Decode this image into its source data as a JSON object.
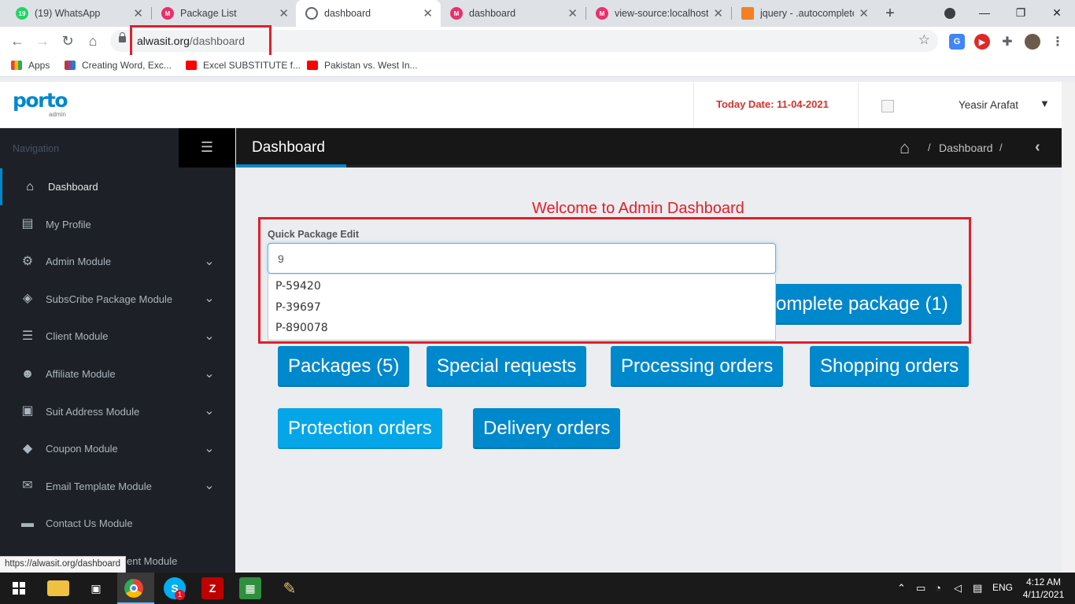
{
  "browser": {
    "tabs": [
      {
        "title": "(19) WhatsApp",
        "icon": "whatsapp-icon",
        "color": "#25d366",
        "badge": "19"
      },
      {
        "title": "Package List",
        "icon": "app-icon",
        "color": "#e8306b"
      },
      {
        "title": "dashboard",
        "icon": "globe-icon",
        "color": "#5f6368",
        "active": true
      },
      {
        "title": "dashboard",
        "icon": "app-icon",
        "color": "#e8306b"
      },
      {
        "title": "view-source:localhost/",
        "icon": "app-icon",
        "color": "#e8306b"
      },
      {
        "title": "jquery - .autocomplete",
        "icon": "stackoverflow-icon",
        "color": "#f48024"
      }
    ],
    "url_domain": "alwasit.org",
    "url_path": "/dashboard",
    "bookmarks": [
      {
        "label": "Apps",
        "icon": "apps-grid-icon"
      },
      {
        "label": "Creating Word, Exc...",
        "icon": "books-icon"
      },
      {
        "label": "Excel SUBSTITUTE f...",
        "icon": "youtube-icon"
      },
      {
        "label": "Pakistan vs. West In...",
        "icon": "youtube-icon"
      }
    ],
    "status_url": "https://alwasit.org/dashboard"
  },
  "header": {
    "logo_text": "porto",
    "logo_sub": "admin",
    "today_date": "Today Date: 11-04-2021",
    "user_name": "Yeasir Arafat"
  },
  "sidebar": {
    "nav_label": "Navigation",
    "items": [
      {
        "label": "Dashboard",
        "icon": "home-icon",
        "glyph": "⌂",
        "active": true,
        "has_caret": false
      },
      {
        "label": "My Profile",
        "icon": "id-card-icon",
        "glyph": "▤",
        "has_caret": false
      },
      {
        "label": "Admin Module",
        "icon": "users-cog-icon",
        "glyph": "⚙",
        "has_caret": true
      },
      {
        "label": "SubsCribe Package Module",
        "icon": "cube-icon",
        "glyph": "◈",
        "has_caret": true
      },
      {
        "label": "Client Module",
        "icon": "list-icon",
        "glyph": "☰",
        "has_caret": true
      },
      {
        "label": "Affiliate Module",
        "icon": "users-icon",
        "glyph": "☻",
        "has_caret": true
      },
      {
        "label": "Suit Address Module",
        "icon": "address-book-icon",
        "glyph": "▣",
        "has_caret": true
      },
      {
        "label": "Coupon Module",
        "icon": "tags-icon",
        "glyph": "◆",
        "has_caret": true
      },
      {
        "label": "Email Template Module",
        "icon": "envelope-icon",
        "glyph": "✉",
        "has_caret": true
      },
      {
        "label": "Contact Us Module",
        "icon": "comment-icon",
        "glyph": "▬",
        "has_caret": false
      }
    ],
    "overflow_item": "ent Module"
  },
  "page": {
    "title": "Dashboard",
    "breadcrumb": "Dashboard",
    "welcome": "Welcome to Admin Dashboard",
    "quick_edit_label": "Quick Package Edit",
    "quick_edit_value": "9",
    "suggestions": [
      "P-59420",
      "P-39697",
      "P-890078"
    ],
    "buttons": {
      "incomplete": "omplete package (1)",
      "packages": "Packages (5)",
      "special": "Special requests",
      "processing": "Processing orders",
      "shopping": "Shopping orders",
      "protection": "Protection orders",
      "delivery": "Delivery orders"
    }
  },
  "taskbar": {
    "language": "ENG",
    "time": "4:12 AM",
    "date": "4/11/2021",
    "skype_badge": "1"
  }
}
